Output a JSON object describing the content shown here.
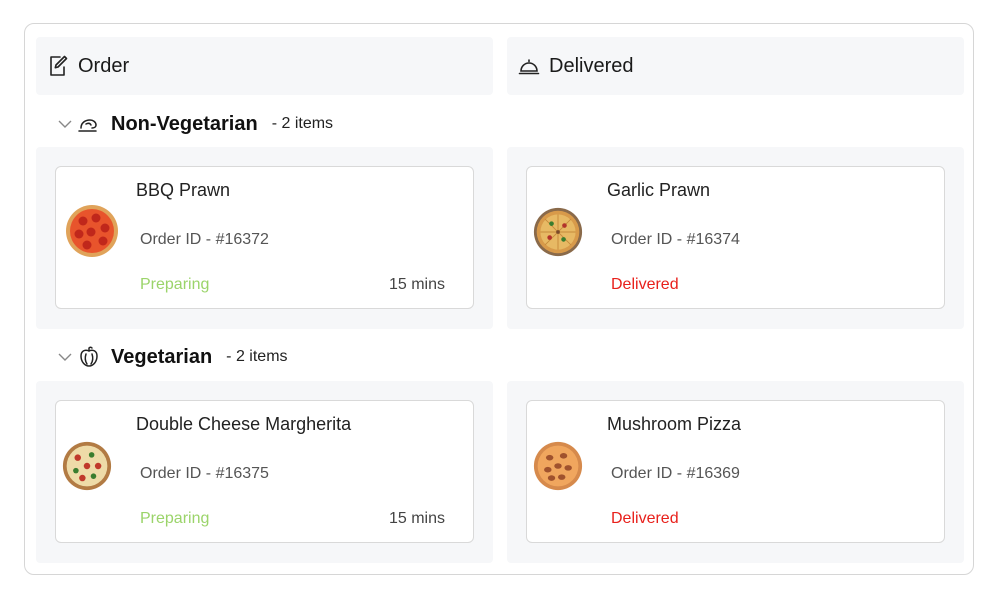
{
  "columns": [
    {
      "label": "Order",
      "icon": "edit-order-icon"
    },
    {
      "label": "Delivered",
      "icon": "cloche-icon"
    }
  ],
  "groups": [
    {
      "title": "Non-Vegetarian",
      "count": "- 2 items",
      "icon": "chicken-leg-icon",
      "cards": [
        {
          "title": "BBQ Prawn",
          "order_id": "Order ID - #16372",
          "status": "Preparing",
          "time": "15 mins"
        },
        {
          "title": "Garlic Prawn",
          "order_id": "Order ID - #16374",
          "status": "Delivered",
          "time": ""
        }
      ]
    },
    {
      "title": "Vegetarian",
      "count": "- 2 items",
      "icon": "bell-pepper-icon",
      "cards": [
        {
          "title": "Double Cheese Margherita",
          "order_id": "Order ID - #16375",
          "status": "Preparing",
          "time": "15 mins"
        },
        {
          "title": "Mushroom Pizza",
          "order_id": "Order ID - #16369",
          "status": "Delivered",
          "time": ""
        }
      ]
    }
  ],
  "colors": {
    "preparing": "#9bd46a",
    "delivered": "#e8201b",
    "lane_bg": "#f6f7f9",
    "border": "#d9d9d9"
  }
}
